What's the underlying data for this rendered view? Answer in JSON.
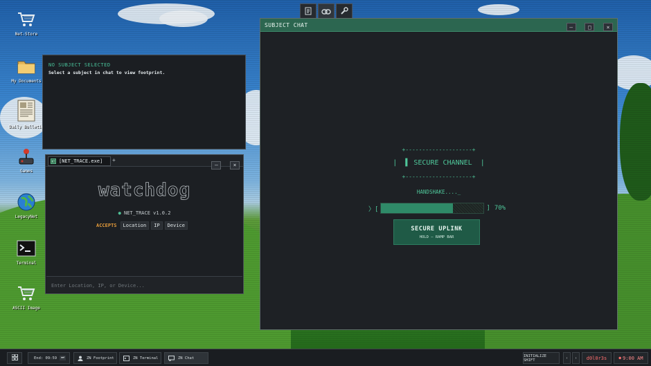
{
  "desktop_icons": [
    {
      "id": "net-store",
      "label": "Net-Store",
      "icon": "cart-icon"
    },
    {
      "id": "my-documents",
      "label": "My Documents",
      "icon": "folder-icon"
    },
    {
      "id": "daily-bulletin",
      "label": "Daily Bulletin",
      "icon": "newspaper-icon"
    },
    {
      "id": "games",
      "label": "Games",
      "icon": "joystick-icon"
    },
    {
      "id": "legacynet",
      "label": "LegacyNet",
      "icon": "globe-icon"
    },
    {
      "id": "terminal",
      "label": "Terminal",
      "icon": "terminal-icon"
    },
    {
      "id": "ascii-image",
      "label": "ASCII Image",
      "icon": "cart-icon"
    }
  ],
  "dock": {
    "buttons": [
      "notebook-icon",
      "link-icon",
      "wrench-icon"
    ]
  },
  "footprint": {
    "heading": "NO SUBJECT SELECTED",
    "subtext": "Select a subject in chat to view footprint."
  },
  "nettrace": {
    "tab_label": "[NET_TRACE.exe]",
    "tab_icon_text": "NT",
    "new_tab": "+",
    "minimize": "–",
    "close": "×",
    "logo": "watchdog",
    "version_dot": "●",
    "version": "NET_TRACE v1.0.2",
    "accepts_label": "ACCEPTS",
    "accepts": [
      "Location",
      "IP",
      "Device"
    ],
    "input_placeholder": "Enter Location, IP, or Device..."
  },
  "chat": {
    "title": "SUBJECT CHAT",
    "minimize": "–",
    "maximize": "□",
    "close": "×",
    "border_top": "+--------------------+",
    "secure_channel": "|  ▌ SECURE CHANNEL  |",
    "border_bottom": "+--------------------+",
    "handshake": "HANDSHAKE...._",
    "bar_prefix": "〉[",
    "bar_suffix": "]",
    "progress": 0.7,
    "progress_label": "70%",
    "uplink_label": "SECURE UPLINK",
    "uplink_sub": "HOLD – RAMP BAR"
  },
  "taskbar": {
    "end_label": "End: 09:59",
    "end_btn": "⏭",
    "apps": [
      {
        "label": "ZN Footprint",
        "icon": "user-icon",
        "active": false
      },
      {
        "label": "ZN Terminal",
        "icon": "terminal-icon",
        "active": false
      },
      {
        "label": "ZN Chat",
        "icon": "chat-icon",
        "active": true
      }
    ],
    "initialize_label": "INITIALIZE SHIFT",
    "prev": "‹",
    "next": "›",
    "user": "d0l0r3s",
    "clock_dot": "●",
    "clock": "9:00 AM",
    "colors": {
      "user": "#ff6e6e",
      "clock": "#ff8a8a"
    }
  }
}
